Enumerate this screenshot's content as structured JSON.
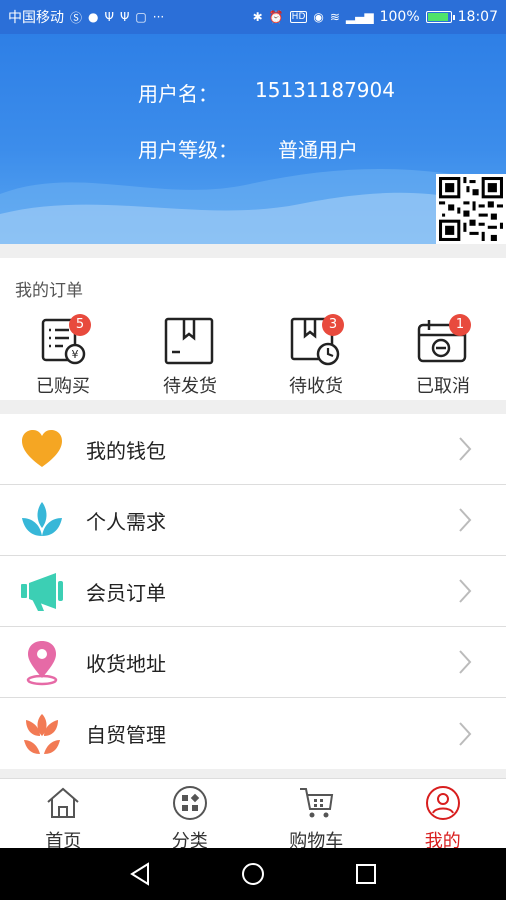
{
  "status_bar": {
    "carrier": "中国移动",
    "battery_percent": "100%",
    "time": "18:07",
    "icons": [
      "s-icon",
      "globe-icon",
      "usb-icon",
      "usb-icon",
      "lock-icon",
      "more-icon",
      "bluetooth-icon",
      "alarm-icon",
      "hd-icon",
      "eye-icon",
      "wifi-icon",
      "signal-icon",
      "battery-icon"
    ]
  },
  "profile": {
    "username_label": "用户名：",
    "username_value": "15131187904",
    "level_label": "用户等级：",
    "level_value": "普通用户"
  },
  "orders": {
    "title": "我的订单",
    "items": [
      {
        "label": "已购买",
        "badge": "5",
        "icon": "purchased-icon"
      },
      {
        "label": "待发货",
        "badge": "",
        "icon": "to-ship-icon"
      },
      {
        "label": "待收货",
        "badge": "3",
        "icon": "to-receive-icon"
      },
      {
        "label": "已取消",
        "badge": "1",
        "icon": "cancelled-icon"
      }
    ]
  },
  "menu": {
    "items": [
      {
        "label": "我的钱包",
        "icon": "heart-icon",
        "color": "#f5a623"
      },
      {
        "label": "个人需求",
        "icon": "lotus-icon",
        "color": "#37b7d8"
      },
      {
        "label": "会员订单",
        "icon": "megaphone-icon",
        "color": "#3ccfb4"
      },
      {
        "label": "收货地址",
        "icon": "location-pin-icon",
        "color": "#e66aa6"
      },
      {
        "label": "自贸管理",
        "icon": "tulip-icon",
        "color": "#f27a54"
      }
    ]
  },
  "tabbar": {
    "items": [
      {
        "label": "首页",
        "icon": "home-icon",
        "active": false
      },
      {
        "label": "分类",
        "icon": "category-icon",
        "active": false
      },
      {
        "label": "购物车",
        "icon": "cart-icon",
        "active": false
      },
      {
        "label": "我的",
        "icon": "profile-icon",
        "active": true
      }
    ],
    "active_color": "#d81e1e"
  }
}
